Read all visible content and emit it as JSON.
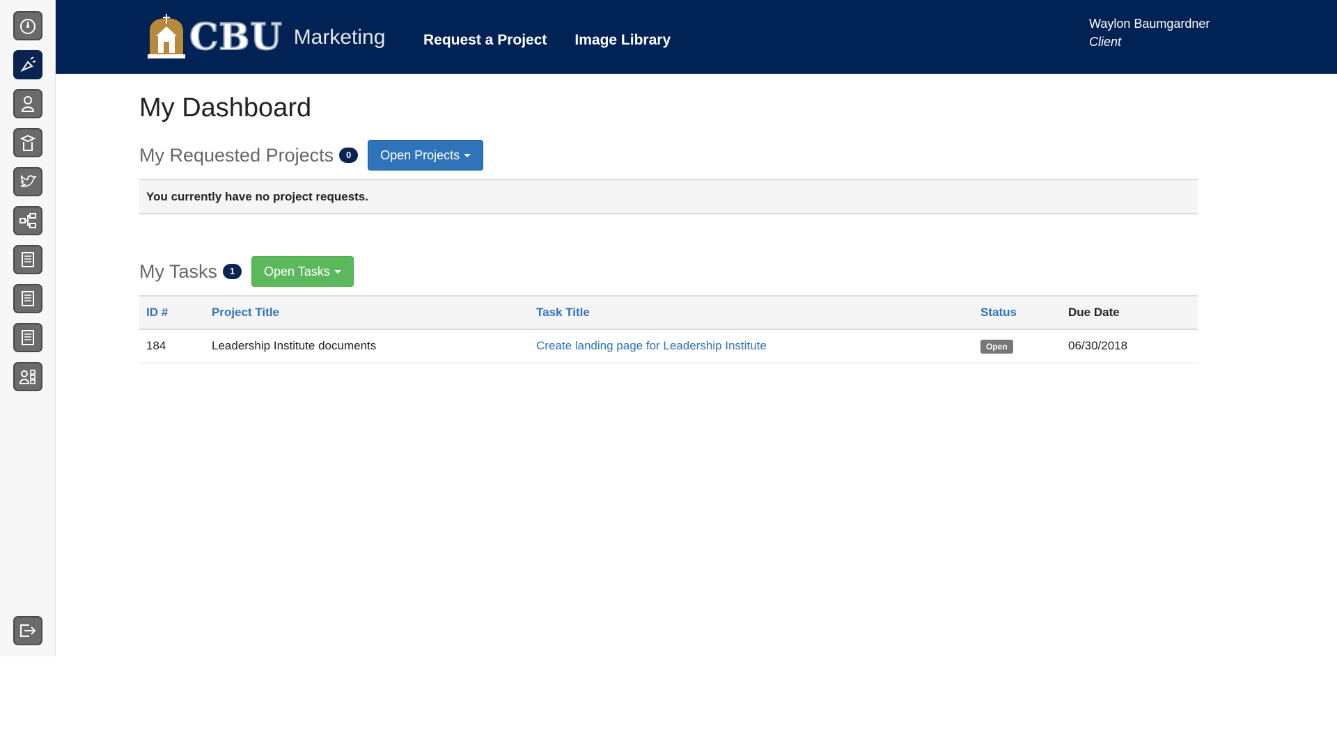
{
  "sidebar": {
    "items": [
      {
        "icon": "dashboard-clock-icon",
        "active": false
      },
      {
        "icon": "marketing-megaphone-icon",
        "active": true
      },
      {
        "icon": "person-icon",
        "active": false
      },
      {
        "icon": "graduate-icon",
        "active": false
      },
      {
        "icon": "twitter-bird-icon",
        "active": false
      },
      {
        "icon": "org-chart-icon",
        "active": false
      },
      {
        "icon": "document-icon",
        "active": false
      },
      {
        "icon": "document-icon",
        "active": false
      },
      {
        "icon": "document-icon",
        "active": false
      },
      {
        "icon": "directory-icon",
        "active": false
      }
    ],
    "logout_icon": "logout-arrow-icon"
  },
  "header": {
    "logo_text": "CBU",
    "logo_subtitle": "Marketing",
    "nav": [
      "Request a Project",
      "Image Library"
    ],
    "user_name": "Waylon Baumgardner",
    "user_role": "Client"
  },
  "page_title": "My Dashboard",
  "requested": {
    "title": "My Requested Projects",
    "count": "0",
    "button_label": "Open Projects",
    "empty_message": "You currently have no project requests."
  },
  "tasks": {
    "title": "My Tasks",
    "count": "1",
    "button_label": "Open Tasks",
    "columns": [
      "ID #",
      "Project Title",
      "Task Title",
      "Status",
      "Due Date"
    ],
    "rows": [
      {
        "id": "184",
        "project": "Leadership Institute documents",
        "task": "Create landing page for Leadership Institute",
        "status": "Open",
        "due": "06/30/2018"
      }
    ]
  },
  "colors": {
    "header_bg": "#002254",
    "primary_button": "#2f73b9",
    "success_button": "#5cb85c",
    "link": "#2f73b9",
    "badge": "#0b2350"
  }
}
